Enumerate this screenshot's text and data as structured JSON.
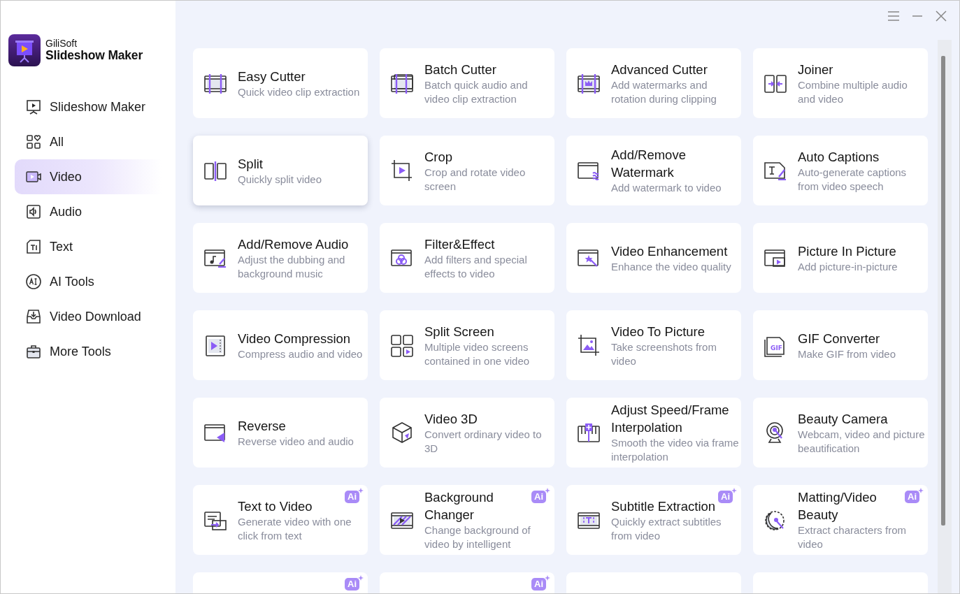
{
  "app": {
    "brand": "GiliSoft",
    "product": "Slideshow Maker"
  },
  "sidebar": {
    "items": [
      {
        "label": "Slideshow Maker",
        "selected": false
      },
      {
        "label": "All",
        "selected": false
      },
      {
        "label": "Video",
        "selected": true
      },
      {
        "label": "Audio",
        "selected": false
      },
      {
        "label": "Text",
        "selected": false
      },
      {
        "label": "AI Tools",
        "selected": false
      },
      {
        "label": "Video Download",
        "selected": false
      },
      {
        "label": "More Tools",
        "selected": false
      }
    ]
  },
  "tools": [
    {
      "title": "Easy Cutter",
      "description": "Quick video clip extraction",
      "hovered": false
    },
    {
      "title": "Batch Cutter",
      "description": "Batch quick audio and video clip extraction",
      "hovered": false
    },
    {
      "title": "Advanced Cutter",
      "description": "Add watermarks and rotation during clipping",
      "hovered": false
    },
    {
      "title": "Joiner",
      "description": "Combine multiple audio and video",
      "hovered": false
    },
    {
      "title": "Split",
      "description": "Quickly split video",
      "hovered": true
    },
    {
      "title": "Crop",
      "description": "Crop and rotate video screen",
      "hovered": false
    },
    {
      "title": "Add/Remove Watermark",
      "description": "Add watermark to video",
      "hovered": false
    },
    {
      "title": "Auto Captions",
      "description": "Auto-generate captions from video speech",
      "hovered": false
    },
    {
      "title": "Add/Remove Audio",
      "description": "Adjust the dubbing and background music",
      "hovered": false
    },
    {
      "title": "Filter&Effect",
      "description": "Add filters and special effects to video",
      "hovered": false
    },
    {
      "title": "Video Enhancement",
      "description": "Enhance the video quality",
      "hovered": false
    },
    {
      "title": "Picture In Picture",
      "description": "Add picture-in-picture",
      "hovered": false
    },
    {
      "title": "Video Compression",
      "description": "Compress audio and video",
      "hovered": false
    },
    {
      "title": "Split Screen",
      "description": "Multiple video screens contained in one video",
      "hovered": false
    },
    {
      "title": "Video To Picture",
      "description": "Take screenshots from video",
      "hovered": false
    },
    {
      "title": "GIF Converter",
      "description": "Make GIF from video",
      "hovered": false,
      "icon_label": "GIF"
    },
    {
      "title": "Reverse",
      "description": "Reverse video and audio",
      "hovered": false
    },
    {
      "title": "Video 3D",
      "description": "Convert ordinary video to 3D",
      "hovered": false
    },
    {
      "title": "Adjust Speed/Frame Interpolation",
      "description": "Smooth the video via frame interpolation",
      "hovered": false
    },
    {
      "title": "Beauty Camera",
      "description": "Webcam, video and picture beautification",
      "hovered": false
    },
    {
      "title": "Text to Video",
      "description": "Generate video with one click from text",
      "hovered": false,
      "badge": "Ai"
    },
    {
      "title": "Background Changer",
      "description": "Change background of video by intelligent",
      "hovered": false,
      "badge": "Ai"
    },
    {
      "title": "Subtitle Extraction",
      "description": "Quickly extract subtitles from video",
      "hovered": false,
      "badge": "Ai"
    },
    {
      "title": "Matting/Video Beauty",
      "description": "Extract characters from video",
      "hovered": false,
      "badge": "Ai"
    },
    {
      "ai": true,
      "badge": "Ai"
    },
    {
      "ai": true,
      "badge": "Ai"
    },
    {
      "ai": false
    },
    {
      "ai": false
    }
  ]
}
